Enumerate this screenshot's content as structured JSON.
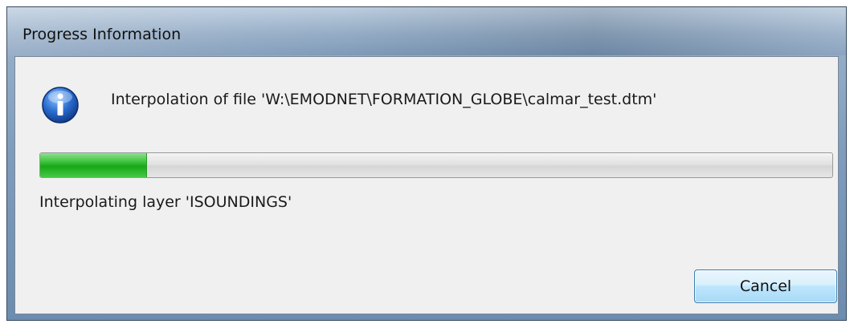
{
  "window": {
    "title": "Progress Information"
  },
  "dialog": {
    "icon": "info-icon",
    "message": "Interpolation of file 'W:\\EMODNET\\FORMATION_GLOBE\\calmar_test.dtm'",
    "progress_fraction": 0.135,
    "status": "Interpolating layer 'ISOUNDINGS'",
    "cancel_label": "Cancel"
  },
  "colors": {
    "progress_green": "#17a817",
    "info_icon_blue": "#1d5fbf",
    "dialog_background": "#f0f0f0"
  }
}
